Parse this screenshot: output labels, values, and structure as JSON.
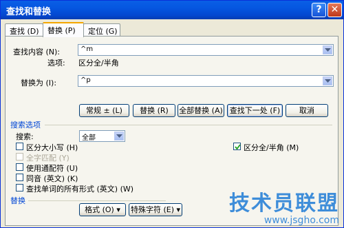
{
  "window": {
    "title": "查找和替换"
  },
  "tabs": [
    {
      "label": "查找 (D)"
    },
    {
      "label": "替换 (P)"
    },
    {
      "label": "定位 (G)"
    }
  ],
  "find": {
    "label": "查找内容 (N):",
    "value": "^m",
    "options_label": "选项:",
    "options_value": "区分全/半角"
  },
  "replace": {
    "label": "替换为 (I):",
    "value": "^p"
  },
  "buttons": {
    "normal": "常规 ± (L)",
    "replace": "替换 (R)",
    "replace_all": "全部替换 (A)",
    "find_next": "查找下一处 (F)",
    "cancel": "取消",
    "format": "格式 (O) ▾",
    "special": "特殊字符 (E) ▾"
  },
  "search_options": {
    "header": "搜索选项",
    "search_label": "搜索:",
    "search_value": "全部",
    "checkboxes": [
      {
        "label": "区分大小写 (H)",
        "checked": false,
        "disabled": false
      },
      {
        "label": "全字匹配 (Y)",
        "checked": false,
        "disabled": true
      },
      {
        "label": "使用通配符 (U)",
        "checked": false,
        "disabled": false
      },
      {
        "label": "同音 (英文) (K)",
        "checked": false,
        "disabled": false
      },
      {
        "label": "查找单词的所有形式 (英文) (W)",
        "checked": false,
        "disabled": false
      }
    ],
    "halfwidth": {
      "label": "区分全/半角 (M)",
      "checked": true
    }
  },
  "replace_section": {
    "header": "替换"
  },
  "watermark": {
    "text": "技术员联盟",
    "url": "www.jsgho.com"
  },
  "colors": {
    "accent": "#0a5fe6",
    "section_header": "#0046d5",
    "tab_highlight": "#f5a700"
  }
}
